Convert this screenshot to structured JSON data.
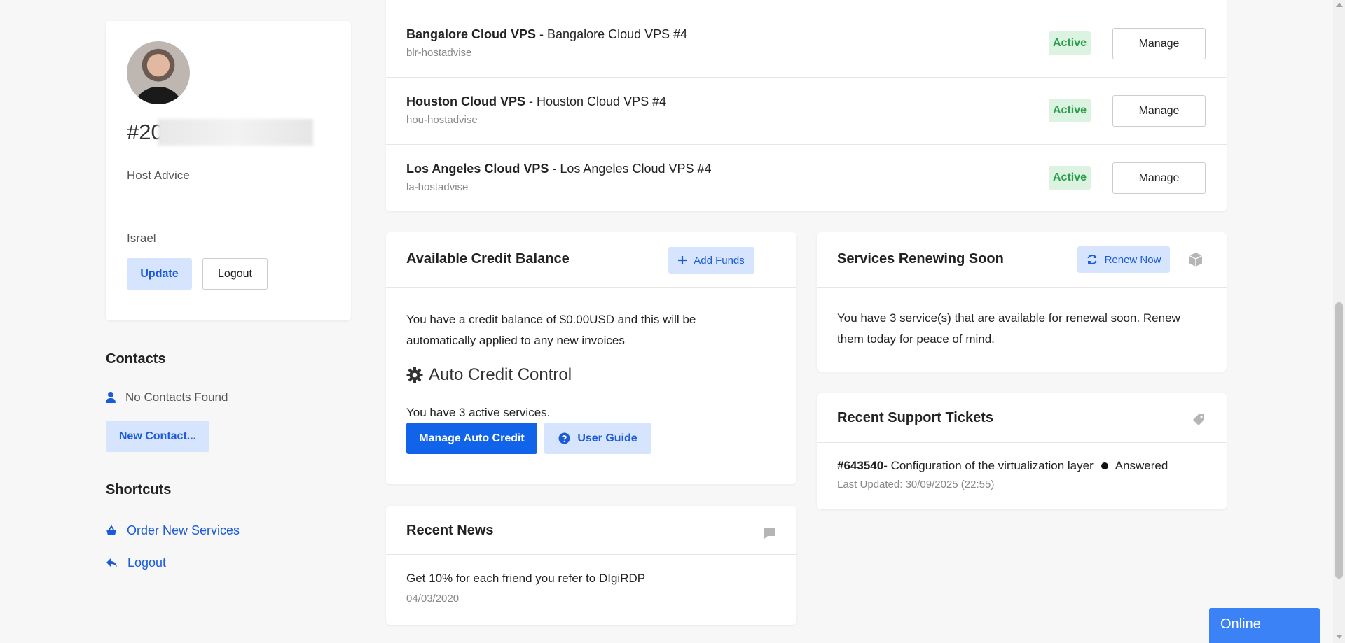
{
  "profile": {
    "client_id_prefix": "#20",
    "company": "Host Advice",
    "country": "Israel",
    "update_label": "Update",
    "logout_label": "Logout"
  },
  "contacts": {
    "title": "Contacts",
    "empty_text": "No Contacts Found",
    "new_contact_label": "New Contact..."
  },
  "shortcuts": {
    "title": "Shortcuts",
    "items": [
      {
        "label": "Order New Services",
        "icon": "basket-icon"
      },
      {
        "label": "Logout",
        "icon": "reply-icon"
      }
    ]
  },
  "services": [
    {
      "product": "Bangalore Cloud VPS",
      "name": " - Bangalore Cloud VPS #4",
      "domain": "blr-hostadvise",
      "status": "Active",
      "action": "Manage"
    },
    {
      "product": "Houston Cloud VPS",
      "name": " - Houston Cloud VPS #4",
      "domain": "hou-hostadvise",
      "status": "Active",
      "action": "Manage"
    },
    {
      "product": "Los Angeles Cloud VPS",
      "name": " - Los Angeles Cloud VPS #4",
      "domain": "la-hostadvise",
      "status": "Active",
      "action": "Manage"
    }
  ],
  "credit": {
    "title": "Available Credit Balance",
    "add_funds_label": "Add Funds",
    "text_line1": "You have a credit balance of $0.00USD and this will be",
    "text_line2": "automatically applied to any new invoices",
    "auto_title": "Auto Credit Control",
    "active_services_text": "You have 3 active services.",
    "manage_label": "Manage Auto Credit",
    "guide_label": "User Guide"
  },
  "renew": {
    "title": "Services Renewing Soon",
    "button_label": "Renew Now",
    "text_line1": "You have 3 service(s) that are available for renewal soon. Renew",
    "text_line2": "them today for peace of mind."
  },
  "tickets": {
    "title": "Recent Support Tickets",
    "items": [
      {
        "id": "#643540",
        "subject": " - Configuration of the virtualization layer",
        "status": "Answered",
        "updated": "Last Updated: 30/09/2025 (22:55)"
      }
    ]
  },
  "news": {
    "title": "Recent News",
    "items": [
      {
        "headline": "Get 10% for each friend you refer to DIgiRDP",
        "date": "04/03/2020"
      }
    ]
  },
  "chat": {
    "label": "Online"
  },
  "colors": {
    "accent": "#1164ea",
    "accent_light": "#d6e4fd",
    "success": "#2a9e4a",
    "success_bg": "#dcf3e1"
  }
}
